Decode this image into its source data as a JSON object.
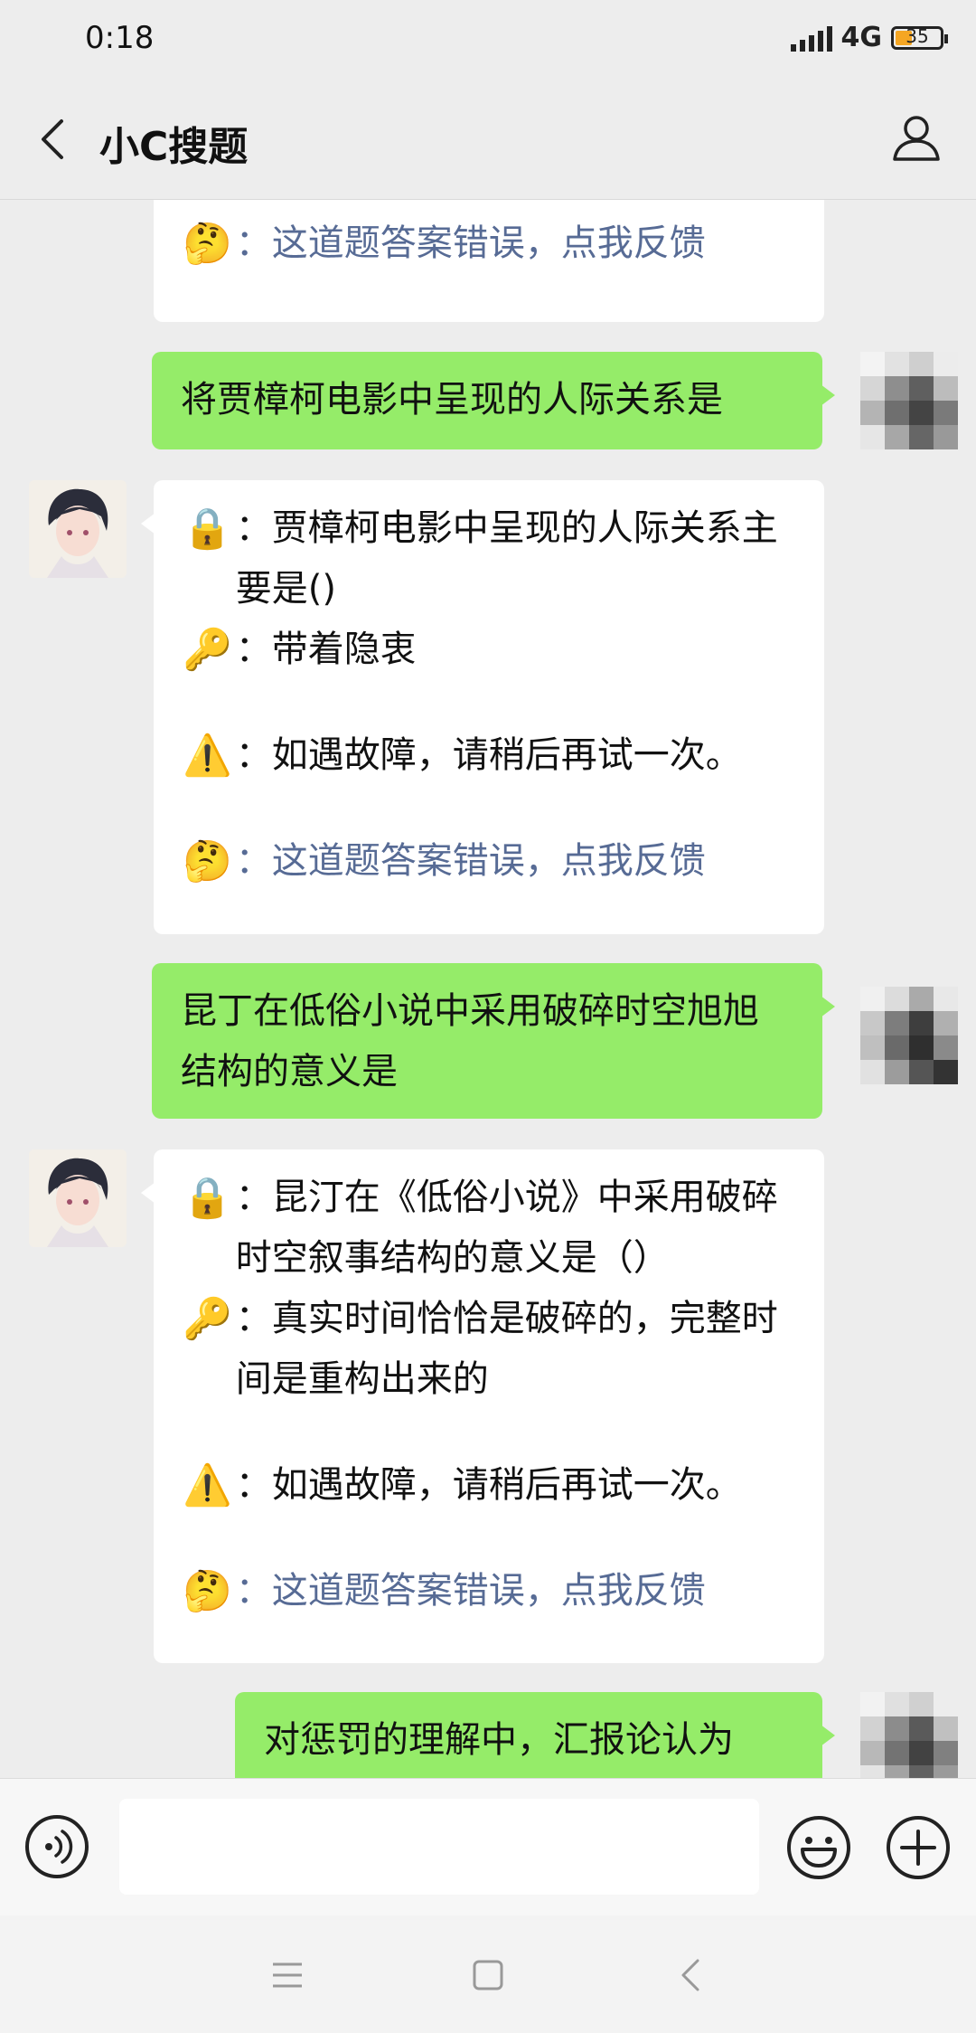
{
  "status": {
    "time": "0:18",
    "network": "4G",
    "battery": "35"
  },
  "header": {
    "title": "小C搜题"
  },
  "messages": {
    "m0": {
      "feedback_emoji": "🤔",
      "feedback": "：这道题答案错误，点我反馈"
    },
    "m1": {
      "text": "将贾樟柯电影中呈现的人际关系是"
    },
    "m2": {
      "question_emoji": "🔒",
      "question": "：贾樟柯电影中呈现的人际关系主要是()",
      "answer_emoji": "🔑",
      "answer": "：带着隐衷",
      "warning_emoji": "⚠️",
      "warning": "：如遇故障，请稍后再试一次。",
      "feedback_emoji": "🤔",
      "feedback": "：这道题答案错误，点我反馈"
    },
    "m3": {
      "text": "昆丁在低俗小说中采用破碎时空旭旭结构的意义是"
    },
    "m4": {
      "question_emoji": "🔒",
      "question": "：昆汀在《低俗小说》中采用破碎时空叙事结构的意义是（）",
      "answer_emoji": "🔑",
      "answer": "：真实时间恰恰是破碎的，完整时间是重构出来的",
      "warning_emoji": "⚠️",
      "warning": "：如遇故障，请稍后再试一次。",
      "feedback_emoji": "🤔",
      "feedback": "：这道题答案错误，点我反馈"
    },
    "m5": {
      "text": "对惩罚的理解中，汇报论认为"
    }
  },
  "input": {
    "value": "",
    "placeholder": ""
  },
  "icons": {
    "back": "chevron-left-icon",
    "profile": "person-icon",
    "voice": "voice-icon",
    "emoji": "smiley-icon",
    "plus": "plus-icon",
    "nav_menu": "menu-icon",
    "nav_home": "square-icon",
    "nav_back": "back-triangle-icon"
  },
  "colors": {
    "accent_green": "#95ec69",
    "link_blue": "#576b95",
    "background": "#ededed"
  }
}
